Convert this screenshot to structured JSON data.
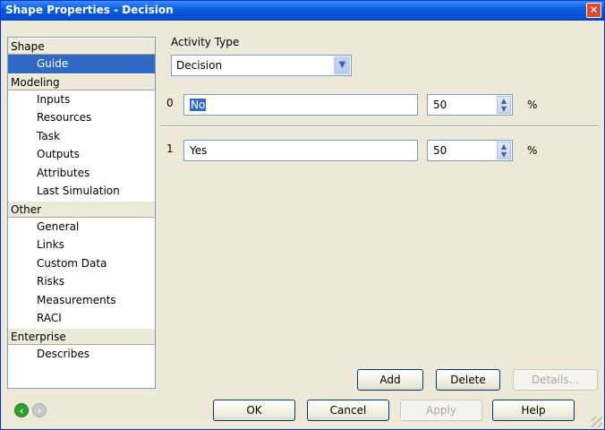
{
  "window": {
    "title": "Shape Properties - Decision",
    "close_glyph": "✕"
  },
  "nav": {
    "groups": [
      {
        "label": "Shape",
        "items": [
          {
            "label": "Guide",
            "selected": true
          }
        ]
      },
      {
        "label": "Modeling",
        "items": [
          {
            "label": "Inputs"
          },
          {
            "label": "Resources"
          },
          {
            "label": "Task"
          },
          {
            "label": "Outputs"
          },
          {
            "label": "Attributes"
          },
          {
            "label": "Last Simulation"
          }
        ]
      },
      {
        "label": "Other",
        "items": [
          {
            "label": "General"
          },
          {
            "label": "Links"
          },
          {
            "label": "Custom Data"
          },
          {
            "label": "Risks"
          },
          {
            "label": "Measurements"
          },
          {
            "label": "RACI"
          }
        ]
      },
      {
        "label": "Enterprise",
        "items": [
          {
            "label": "Describes"
          }
        ]
      }
    ]
  },
  "guide": {
    "activity_type_label": "Activity Type",
    "activity_type_value": "Decision",
    "outcomes": [
      {
        "index": "0",
        "name": "No",
        "percent": "50",
        "unit": "%"
      },
      {
        "index": "1",
        "name": "Yes",
        "percent": "50",
        "unit": "%"
      }
    ]
  },
  "buttons": {
    "add": "Add",
    "delete": "Delete",
    "details": "Details...",
    "ok": "OK",
    "cancel": "Cancel",
    "apply": "Apply",
    "help": "Help"
  },
  "icons": {
    "back": "back-arrow-icon",
    "forward": "forward-arrow-icon"
  },
  "colors": {
    "title_bar": "#0a5fe0",
    "selection": "#316ac5",
    "back_arrow": "#2f9e2f",
    "forward_arrow": "#c8c8c8"
  }
}
